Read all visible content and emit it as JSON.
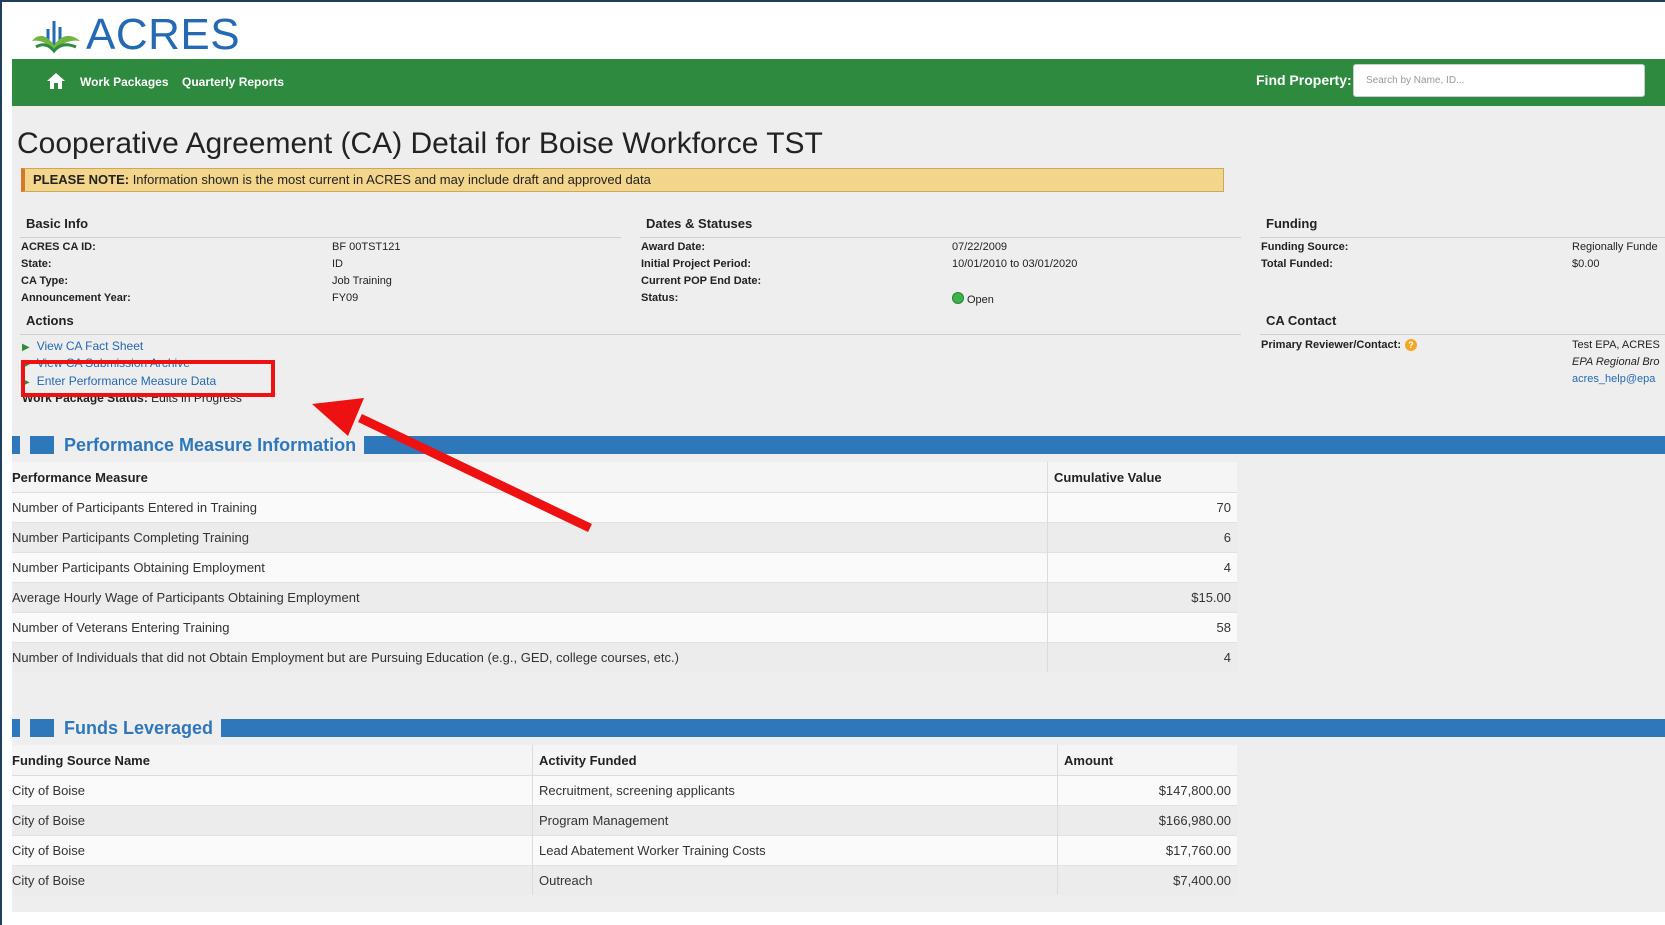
{
  "app": {
    "logo_text": "ACRES"
  },
  "nav": {
    "links": [
      "Work Packages",
      "Quarterly Reports"
    ],
    "find_label": "Find Property:",
    "search_placeholder": "Search by Name, ID..."
  },
  "page": {
    "title": "Cooperative Agreement (CA) Detail for Boise Workforce TST",
    "notice_bold": "PLEASE NOTE:",
    "notice_text": " Information shown is the most current in ACRES and may include draft and approved data"
  },
  "basic_info": {
    "heading": "Basic Info",
    "rows": [
      {
        "label": "ACRES CA ID:",
        "value": "BF 00TST121"
      },
      {
        "label": "State:",
        "value": "ID"
      },
      {
        "label": "CA Type:",
        "value": "Job Training"
      },
      {
        "label": "Announcement Year:",
        "value": "FY09"
      }
    ]
  },
  "dates": {
    "heading": "Dates & Statuses",
    "rows": [
      {
        "label": "Award Date:",
        "value": "07/22/2009"
      },
      {
        "label": "Initial Project Period:",
        "value": "10/01/2010 to 03/01/2020"
      },
      {
        "label": "Current POP End Date:",
        "value": ""
      },
      {
        "label": "Status:",
        "value": "Open"
      }
    ]
  },
  "funding": {
    "heading": "Funding",
    "rows": [
      {
        "label": "Funding Source:",
        "value": "Regionally Funde"
      },
      {
        "label": "Total Funded:",
        "value": "$0.00"
      }
    ]
  },
  "actions": {
    "heading": "Actions",
    "items": [
      "View CA Fact Sheet",
      "View CA Submission Archive",
      "Enter Performance Measure Data"
    ],
    "work_package_label": "Work Package Status:",
    "work_package_value": " Edits in Progress"
  },
  "contact": {
    "heading": "CA Contact",
    "label": "Primary Reviewer/Contact:",
    "name": "Test EPA, ACRES",
    "org": "EPA Regional Bro",
    "email": "acres_help@epa"
  },
  "performance": {
    "heading": "Performance Measure Information",
    "columns": [
      "Performance Measure",
      "Cumulative Value"
    ],
    "rows": [
      {
        "measure": "Number of Participants Entered in Training",
        "value": "70"
      },
      {
        "measure": "Number Participants Completing Training",
        "value": "6"
      },
      {
        "measure": "Number Participants Obtaining Employment",
        "value": "4"
      },
      {
        "measure": "Average Hourly Wage of Participants Obtaining Employment",
        "value": "$15.00"
      },
      {
        "measure": "Number of Veterans Entering Training",
        "value": "58"
      },
      {
        "measure": "Number of Individuals that did not Obtain Employment but are Pursuing Education (e.g., GED, college courses, etc.)",
        "value": "4"
      }
    ]
  },
  "funds": {
    "heading": "Funds Leveraged",
    "columns": [
      "Funding Source Name",
      "Activity Funded",
      "Amount"
    ],
    "rows": [
      {
        "source": "City of Boise",
        "activity": "Recruitment, screening applicants",
        "amount": "$147,800.00"
      },
      {
        "source": "City of Boise",
        "activity": "Program Management",
        "amount": "$166,980.00"
      },
      {
        "source": "City of Boise",
        "activity": "Lead Abatement Worker Training Costs",
        "amount": "$17,760.00"
      },
      {
        "source": "City of Boise",
        "activity": "Outreach",
        "amount": "$7,400.00"
      }
    ]
  },
  "colors": {
    "nav_green": "#2e8a3e",
    "brand_blue": "#2469b3",
    "section_blue": "#2e77bb",
    "notice_yellow": "#f3d58c",
    "annotation_red": "#ee1111"
  },
  "icons": [
    "home-icon",
    "acres-logo-icon",
    "triangle-bullet-icon",
    "status-open-icon",
    "help-icon"
  ]
}
